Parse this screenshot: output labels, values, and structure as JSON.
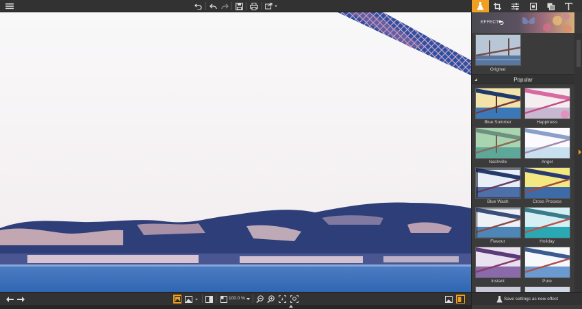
{
  "toolbar": {
    "icons": [
      "menu-icon",
      "undo-history-icon",
      "undo-icon",
      "redo-icon",
      "save-icon",
      "print-icon",
      "share-icon"
    ]
  },
  "bottombar": {
    "zoom": "100.0 %",
    "icons": [
      "prev-image-icon",
      "next-image-icon",
      "single-view-icon",
      "adjust-view-icon",
      "compare-icon",
      "fit-window-icon",
      "zoom-out-icon",
      "zoom-in-icon",
      "actual-size-icon",
      "fit-zoom-icon",
      "fullscreen-icon",
      "panel-toggle-icon"
    ]
  },
  "panel": {
    "tabs": [
      "effects-tab",
      "crop-tab",
      "adjust-tab",
      "frame-tab",
      "layers-tab",
      "text-tab"
    ],
    "effects_label": "EFFECTS:",
    "original_label": "Original",
    "section_title": "Popular",
    "thumbnails": [
      {
        "label": "Blue Summer"
      },
      {
        "label": "Happiness"
      },
      {
        "label": "Nashville"
      },
      {
        "label": "Angel"
      },
      {
        "label": "Blue Wash"
      },
      {
        "label": "Cross Process"
      },
      {
        "label": "Flavour"
      },
      {
        "label": "Holiday"
      },
      {
        "label": "Instant"
      },
      {
        "label": "Pure"
      }
    ],
    "save_label": "Save settings as new effect"
  },
  "colors": {
    "accent": "#f0a020",
    "toolbar": "#323232",
    "panel": "#3a3a3a",
    "water": "#3a6fb8",
    "hills": "#2d3e78"
  }
}
